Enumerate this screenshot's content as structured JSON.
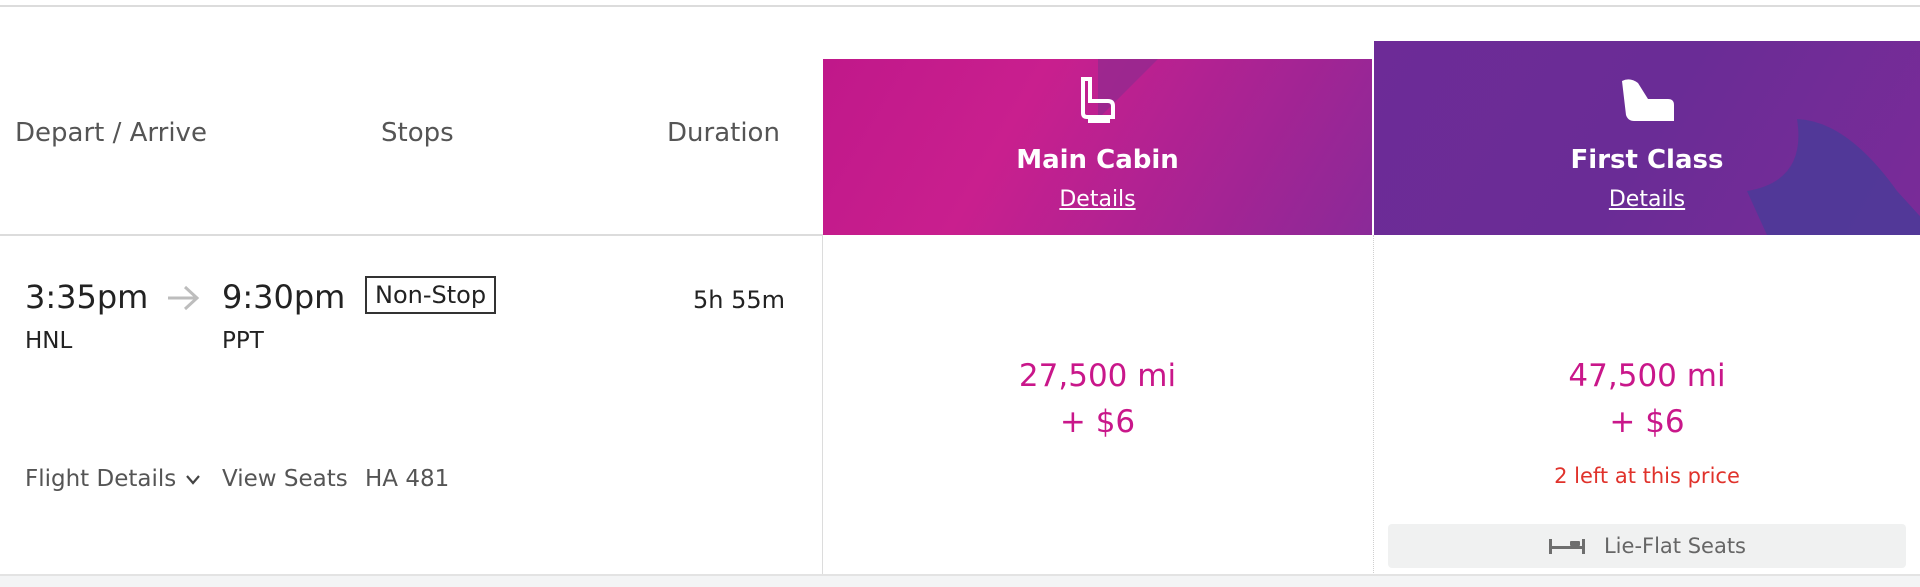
{
  "header": {
    "depart_arrive": "Depart / Arrive",
    "stops": "Stops",
    "duration": "Duration"
  },
  "cabins": [
    {
      "title": "Main Cabin",
      "link": "Details",
      "icon": "economy-seat-icon",
      "color": "#c0188a"
    },
    {
      "title": "First Class",
      "link": "Details",
      "icon": "first-class-seat-icon",
      "color": "#6d2b97"
    }
  ],
  "flight": {
    "depart_time": "3:35pm",
    "arrive_time": "9:30pm",
    "origin": "HNL",
    "destination": "PPT",
    "stops": "Non-Stop",
    "duration": "5h 55m",
    "flight_details_label": "Flight Details",
    "view_seats_label": "View Seats",
    "flight_number": "HA 481"
  },
  "fares": {
    "main": {
      "miles": "27,500 mi",
      "fee": "+ $6"
    },
    "first": {
      "miles": "47,500 mi",
      "fee": "+ $6",
      "availability": "2 left at this price",
      "amenity": "Lie-Flat Seats"
    }
  },
  "colors": {
    "price": "#c9178a",
    "warning": "#e0322b"
  }
}
